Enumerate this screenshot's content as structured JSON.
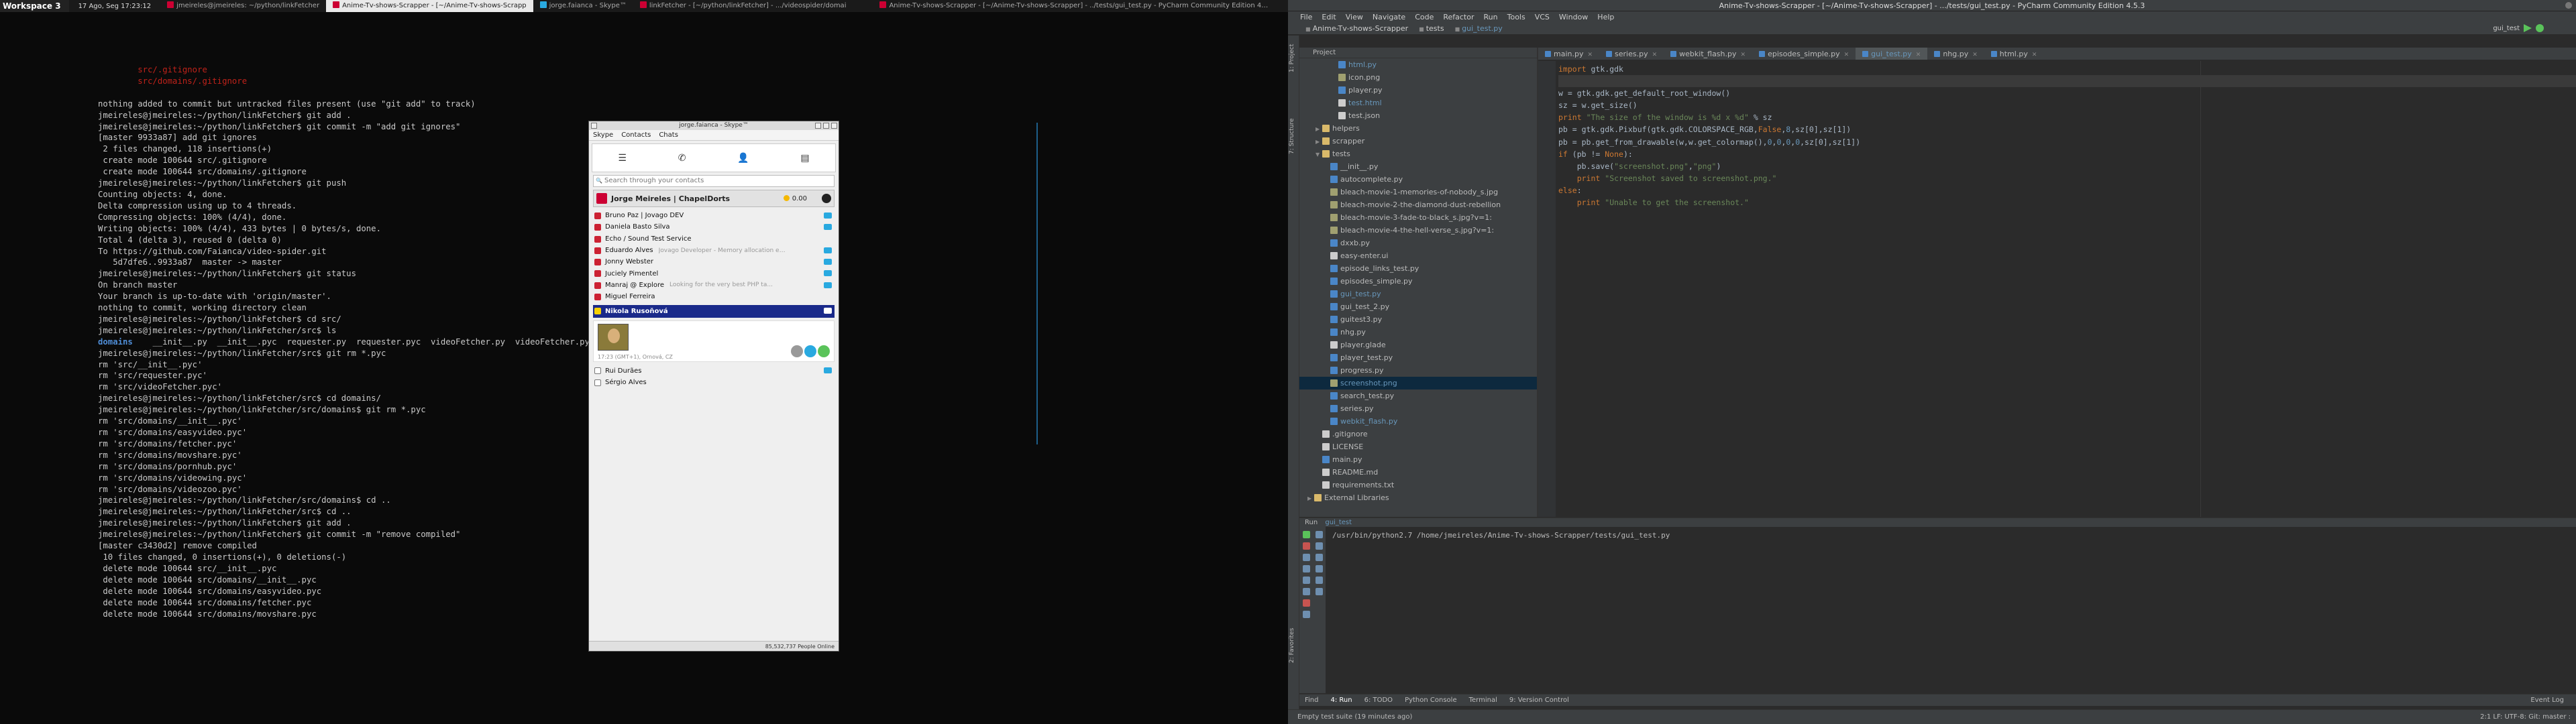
{
  "topbar": {
    "workspace": "Workspace 3",
    "clock": "17 Ago, Seg 17:23:12",
    "tasks": [
      {
        "label": "jmeireles@jmeireles: ~/python/linkFetcher",
        "active": false,
        "icon": "terminal"
      },
      {
        "label": "Anime-Tv-shows-Scrapper - [~/Anime-Tv-shows-Scrapp",
        "active": true,
        "icon": "pycharm"
      },
      {
        "label": "jorge.faianca - Skype™",
        "active": false,
        "icon": "skype"
      },
      {
        "label": "linkFetcher - [~/python/linkFetcher] - .../videospider/domai",
        "active": false,
        "icon": "pycharm"
      },
      {
        "label": "Anime-Tv-shows-Scrapper - [~/Anime-Tv-shows-Scrapper] - ../tests/gui_test.py - PyCharm Community Edition 4.5.3",
        "active": false,
        "icon": "pycharm"
      }
    ]
  },
  "terminal": {
    "lines": [
      {
        "t": "        src/.gitignore",
        "c": "red"
      },
      {
        "t": "        src/domains/.gitignore",
        "c": "red"
      },
      {
        "t": ""
      },
      {
        "t": "nothing added to commit but untracked files present (use \"git add\" to track)"
      },
      {
        "t": "jmeireles@jmeireles:~/python/linkFetcher$ git add ."
      },
      {
        "t": "jmeireles@jmeireles:~/python/linkFetcher$ git commit -m \"add git ignores\""
      },
      {
        "t": "[master 9933a87] add git ignores"
      },
      {
        "t": " 2 files changed, 118 insertions(+)"
      },
      {
        "t": " create mode 100644 src/.gitignore"
      },
      {
        "t": " create mode 100644 src/domains/.gitignore"
      },
      {
        "t": "jmeireles@jmeireles:~/python/linkFetcher$ git push"
      },
      {
        "t": "Counting objects: 4, done."
      },
      {
        "t": "Delta compression using up to 4 threads."
      },
      {
        "t": "Compressing objects: 100% (4/4), done."
      },
      {
        "t": "Writing objects: 100% (4/4), 433 bytes | 0 bytes/s, done."
      },
      {
        "t": "Total 4 (delta 3), reused 0 (delta 0)"
      },
      {
        "t": "To https://github.com/Faianca/video-spider.git"
      },
      {
        "t": "   5d7dfe6..9933a87  master -> master"
      },
      {
        "t": "jmeireles@jmeireles:~/python/linkFetcher$ git status"
      },
      {
        "t": "On branch master"
      },
      {
        "t": "Your branch is up-to-date with 'origin/master'."
      },
      {
        "t": "nothing to commit, working directory clean"
      },
      {
        "t": "jmeireles@jmeireles:~/python/linkFetcher$ cd src/"
      },
      {
        "t": "jmeireles@jmeireles:~/python/linkFetcher/src$ ls"
      },
      {
        "t": "__init__.py  __init__.pyc  requester.py  requester.pyc  videoFetcher.py  videoFetcher.pyc",
        "prefix": "domains"
      },
      {
        "t": "jmeireles@jmeireles:~/python/linkFetcher/src$ git rm *.pyc"
      },
      {
        "t": "rm 'src/__init__.pyc'"
      },
      {
        "t": "rm 'src/requester.pyc'"
      },
      {
        "t": "rm 'src/videoFetcher.pyc'"
      },
      {
        "t": "jmeireles@jmeireles:~/python/linkFetcher/src$ cd domains/"
      },
      {
        "t": "jmeireles@jmeireles:~/python/linkFetcher/src/domains$ git rm *.pyc"
      },
      {
        "t": "rm 'src/domains/__init__.pyc'"
      },
      {
        "t": "rm 'src/domains/easyvideo.pyc'"
      },
      {
        "t": "rm 'src/domains/fetcher.pyc'"
      },
      {
        "t": "rm 'src/domains/movshare.pyc'"
      },
      {
        "t": "rm 'src/domains/pornhub.pyc'"
      },
      {
        "t": "rm 'src/domains/videowing.pyc'"
      },
      {
        "t": "rm 'src/domains/videozoo.pyc'"
      },
      {
        "t": "jmeireles@jmeireles:~/python/linkFetcher/src/domains$ cd .."
      },
      {
        "t": "jmeireles@jmeireles:~/python/linkFetcher/src$ cd .."
      },
      {
        "t": "jmeireles@jmeireles:~/python/linkFetcher$ git add ."
      },
      {
        "t": "jmeireles@jmeireles:~/python/linkFetcher$ git commit -m \"remove compiled\""
      },
      {
        "t": "[master c3430d2] remove compiled"
      },
      {
        "t": " 10 files changed, 0 insertions(+), 0 deletions(-)"
      },
      {
        "t": " delete mode 100644 src/__init__.pyc"
      },
      {
        "t": " delete mode 100644 src/domains/__init__.pyc"
      },
      {
        "t": " delete mode 100644 src/domains/easyvideo.pyc"
      },
      {
        "t": " delete mode 100644 src/domains/fetcher.pyc"
      },
      {
        "t": " delete mode 100644 src/domains/movshare.pyc"
      }
    ]
  },
  "skype": {
    "title": "jorge.faianca - Skype™",
    "menu": [
      "Skype",
      "Contacts",
      "Chats"
    ],
    "search_placeholder": "Search through your contacts",
    "me_name": "Jorge Meireles | ChapelDorts",
    "credit": "0.00",
    "contacts": [
      {
        "name": "Bruno Paz | Jovago DEV",
        "mood": "",
        "status": "online",
        "badge": true
      },
      {
        "name": "Daniela Basto Silva",
        "mood": "",
        "status": "online",
        "badge": true
      },
      {
        "name": "Echo / Sound Test Service",
        "mood": "",
        "status": "online",
        "badge": false
      },
      {
        "name": "Eduardo Alves",
        "mood": "Jovago Developer - Memory allocation err...",
        "status": "online",
        "badge": true
      },
      {
        "name": "Jonny Webster",
        "mood": "",
        "status": "online",
        "badge": true
      },
      {
        "name": "Juciely Pimentel",
        "mood": "",
        "status": "online",
        "badge": true
      },
      {
        "name": "Manraj @ Explore",
        "mood": "Looking for the very best PHP ta...",
        "status": "online",
        "badge": true
      },
      {
        "name": "Miguel Ferreira",
        "mood": "",
        "status": "online",
        "badge": false
      }
    ],
    "selected_name": "Nikola Rusoňová",
    "selected_location": "17:23 (GMT+1), Ornová, CZ",
    "offline": [
      {
        "name": "Rui Durães",
        "status": "offline",
        "badge": true
      },
      {
        "name": "Sérgio Alves",
        "status": "offline",
        "badge": false
      }
    ],
    "footer": "85,532,737 People Online"
  },
  "pycharm": {
    "title": "Anime-Tv-shows-Scrapper - [~/Anime-Tv-shows-Scrapper] - .../tests/gui_test.py - PyCharm Community Edition 4.5.3",
    "menu": [
      "File",
      "Edit",
      "View",
      "Navigate",
      "Code",
      "Refactor",
      "Run",
      "Tools",
      "VCS",
      "Window",
      "Help"
    ],
    "breadcrumbs": [
      "Anime-Tv-shows-Scrapper",
      "tests",
      "gui_test.py"
    ],
    "run_config": "gui_test",
    "project_label": "Project",
    "tree": [
      {
        "label": "html.py",
        "ic": "py",
        "indent": 3,
        "color": "blue"
      },
      {
        "label": "icon.png",
        "ic": "img",
        "indent": 3
      },
      {
        "label": "player.py",
        "ic": "py",
        "indent": 3
      },
      {
        "label": "test.html",
        "ic": "txt",
        "indent": 3,
        "color": "blue"
      },
      {
        "label": "test.json",
        "ic": "txt",
        "indent": 3
      },
      {
        "label": "helpers",
        "ic": "folder",
        "indent": 1,
        "arrow": "▶"
      },
      {
        "label": "scrapper",
        "ic": "folder",
        "indent": 1,
        "arrow": "▶"
      },
      {
        "label": "tests",
        "ic": "folder",
        "indent": 1,
        "arrow": "▼"
      },
      {
        "label": "__init__.py",
        "ic": "py",
        "indent": 2
      },
      {
        "label": "autocomplete.py",
        "ic": "py",
        "indent": 2
      },
      {
        "label": "bleach-movie-1-memories-of-nobody_s.jpg",
        "ic": "img",
        "indent": 2
      },
      {
        "label": "bleach-movie-2-the-diamond-dust-rebellion",
        "ic": "img",
        "indent": 2
      },
      {
        "label": "bleach-movie-3-fade-to-black_s.jpg?v=1:",
        "ic": "img",
        "indent": 2
      },
      {
        "label": "bleach-movie-4-the-hell-verse_s.jpg?v=1:",
        "ic": "img",
        "indent": 2
      },
      {
        "label": "dxxb.py",
        "ic": "py",
        "indent": 2
      },
      {
        "label": "easy-enter.ui",
        "ic": "txt",
        "indent": 2
      },
      {
        "label": "episode_links_test.py",
        "ic": "py",
        "indent": 2
      },
      {
        "label": "episodes_simple.py",
        "ic": "py",
        "indent": 2
      },
      {
        "label": "gui_test.py",
        "ic": "py",
        "indent": 2,
        "color": "blue"
      },
      {
        "label": "gui_test_2.py",
        "ic": "py",
        "indent": 2
      },
      {
        "label": "guitest3.py",
        "ic": "py",
        "indent": 2
      },
      {
        "label": "nhg.py",
        "ic": "py",
        "indent": 2
      },
      {
        "label": "player.glade",
        "ic": "txt",
        "indent": 2
      },
      {
        "label": "player_test.py",
        "ic": "py",
        "indent": 2
      },
      {
        "label": "progress.py",
        "ic": "py",
        "indent": 2
      },
      {
        "label": "screenshot.png",
        "ic": "img",
        "indent": 2,
        "color": "blue",
        "selected": true
      },
      {
        "label": "search_test.py",
        "ic": "py",
        "indent": 2
      },
      {
        "label": "series.py",
        "ic": "py",
        "indent": 2
      },
      {
        "label": "webkit_flash.py",
        "ic": "py",
        "indent": 2,
        "color": "blue"
      },
      {
        "label": ".gitignore",
        "ic": "txt",
        "indent": 1
      },
      {
        "label": "LICENSE",
        "ic": "txt",
        "indent": 1
      },
      {
        "label": "main.py",
        "ic": "py",
        "indent": 1
      },
      {
        "label": "README.md",
        "ic": "txt",
        "indent": 1
      },
      {
        "label": "requirements.txt",
        "ic": "txt",
        "indent": 1
      },
      {
        "label": "External Libraries",
        "ic": "folder",
        "indent": 0,
        "arrow": "▶"
      }
    ],
    "tabs": [
      {
        "label": "main.py",
        "active": false
      },
      {
        "label": "series.py",
        "active": false
      },
      {
        "label": "webkit_flash.py",
        "active": false
      },
      {
        "label": "episodes_simple.py",
        "active": false
      },
      {
        "label": "gui_test.py",
        "active": true
      },
      {
        "label": "nhg.py",
        "active": false
      },
      {
        "label": "html.py",
        "active": false
      }
    ],
    "code": [
      "import gtk.gdk",
      "",
      "w = gtk.gdk.get_default_root_window()",
      "sz = w.get_size()",
      "print \"The size of the window is %d x %d\" % sz",
      "pb = gtk.gdk.Pixbuf(gtk.gdk.COLORSPACE_RGB,False,8,sz[0],sz[1])",
      "pb = pb.get_from_drawable(w,w.get_colormap(),0,0,0,0,sz[0],sz[1])",
      "if (pb != None):",
      "    pb.save(\"screenshot.png\",\"png\")",
      "    print \"Screenshot saved to screenshot.png.\"",
      "else:",
      "    print \"Unable to get the screenshot.\""
    ],
    "run_tab": "Run",
    "run_config_tab": "gui_test",
    "console_line": "/usr/bin/python2.7 /home/jmeireles/Anime-Tv-shows-Scrapper/tests/gui_test.py",
    "bottom_tabs": [
      "4: Run",
      "6: TODO",
      "Python Console",
      "Terminal",
      "9: Version Control",
      "Find"
    ],
    "event_log": "Event Log",
    "status_left": "Empty test suite (19 minutes ago)",
    "status_right": "2:1   LF:  UTF-8:  Git: master :"
  },
  "colors": {
    "accent": "#4f8dd6",
    "terminal_red": "#c0221a",
    "skype_selected": "#1a2a8a"
  }
}
